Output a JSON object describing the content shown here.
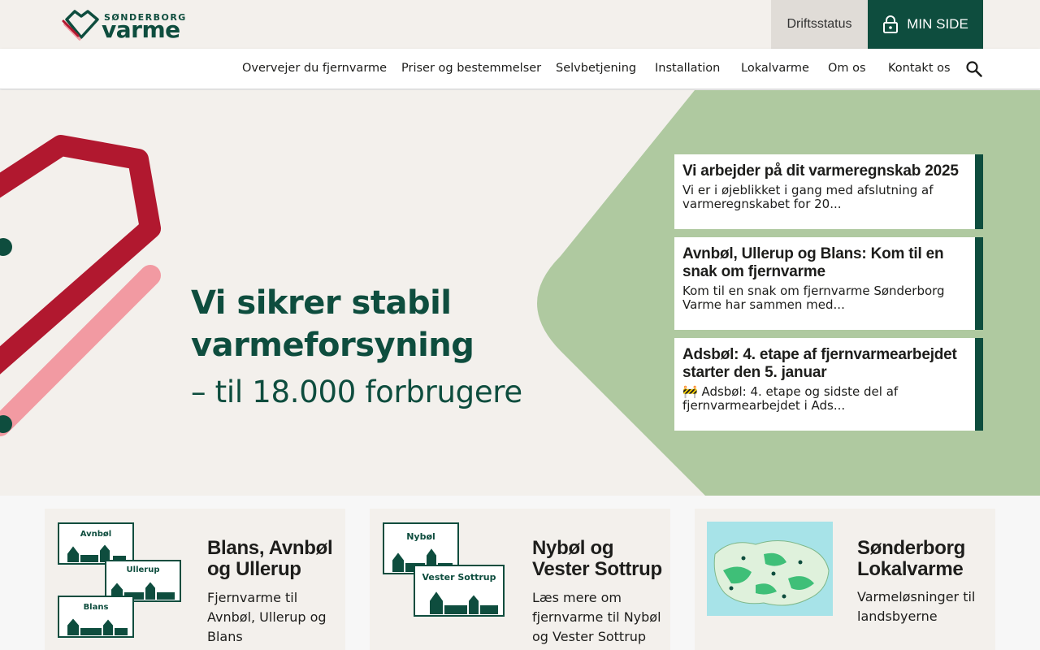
{
  "header": {
    "logo_small": "SØNDERBORG",
    "logo_big": "varme",
    "status_button": "Driftsstatus",
    "my_page_button": "MIN SIDE"
  },
  "nav": {
    "items": [
      "Overvejer du fjernvarme",
      "Priser og bestemmelser",
      "Selvbetjening",
      "Installation",
      "Lokalvarme",
      "Om os",
      "Kontakt os"
    ]
  },
  "hero": {
    "title_line1": "Vi sikrer stabil",
    "title_line2": "varmeforsyning",
    "subtitle": "– til 18.000 forbrugere"
  },
  "news": [
    {
      "title": "Vi arbejder på dit varmeregnskab 2025",
      "text": "Vi er i øjeblikket i gang med afslutning af varmeregnskabet for 20..."
    },
    {
      "title": "Avnbøl, Ullerup og Blans: Kom til en snak om fjernvarme",
      "text": "Kom til en snak om fjernvarme Sønderborg Varme har sammen med..."
    },
    {
      "title": "Adsbøl: 4. etape af fjernvarmearbejdet starter den 5. januar",
      "text": "🚧 Adsbøl: 4. etape og sidste del af fjernvarmearbejdet i Ads..."
    }
  ],
  "cards": [
    {
      "title": "Blans, Avnbøl og Ullerup",
      "text": "Fjernvarme til Avnbøl, Ullerup og Blans",
      "signs": [
        "Avnbøl",
        "Ullerup",
        "Blans"
      ]
    },
    {
      "title": "Nybøl og Vester Sottrup",
      "text": "Læs mere om fjernvarme til Nybøl og Vester Sottrup",
      "signs": [
        "Nybøl",
        "Vester Sottrup"
      ]
    },
    {
      "title": "Sønderborg Lokalvarme",
      "text": "Varmeløsninger til landsbyerne"
    }
  ],
  "colors": {
    "brand_green": "#0e4d3e",
    "hero_green": "#afc9a0",
    "hero_red": "#b1182f",
    "hero_pink": "#f29aa2",
    "beige": "#f3f0ec"
  }
}
